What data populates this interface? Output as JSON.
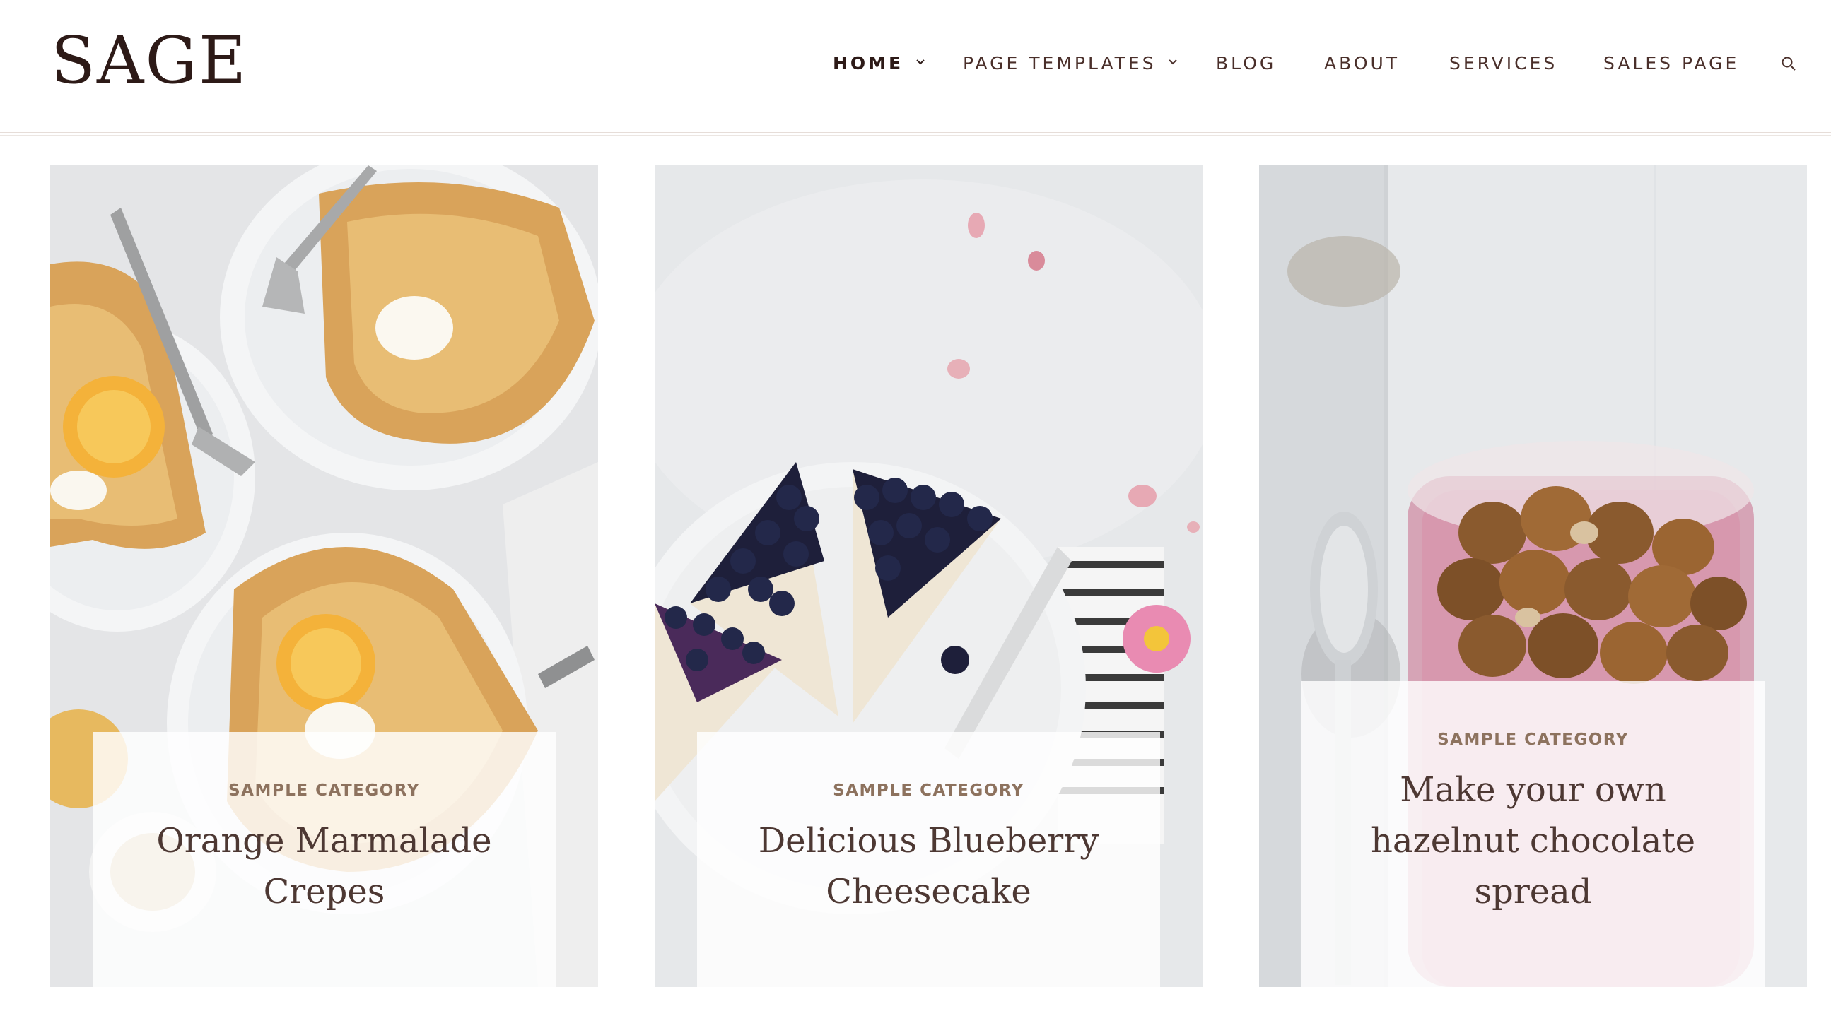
{
  "site": {
    "logo": "SAGE"
  },
  "nav": {
    "items": [
      {
        "label": "HOME",
        "has_dropdown": true,
        "active": true
      },
      {
        "label": "PAGE TEMPLATES",
        "has_dropdown": true,
        "active": false
      },
      {
        "label": "BLOG",
        "has_dropdown": false,
        "active": false
      },
      {
        "label": "ABOUT",
        "has_dropdown": false,
        "active": false
      },
      {
        "label": "SERVICES",
        "has_dropdown": false,
        "active": false
      },
      {
        "label": "SALES PAGE",
        "has_dropdown": false,
        "active": false
      }
    ],
    "search_icon": "search-icon"
  },
  "posts": [
    {
      "category": "SAMPLE CATEGORY",
      "title": "Orange Marmalade Crepes",
      "image": "crepes-photo"
    },
    {
      "category": "SAMPLE CATEGORY",
      "title": "Delicious Blueberry Cheesecake",
      "image": "blueberry-cheesecake-photo"
    },
    {
      "category": "SAMPLE CATEGORY",
      "title": "Make your own hazelnut chocolate spread",
      "image": "hazelnut-jar-photo"
    }
  ],
  "colors": {
    "logo": "#2d1a17",
    "nav_text": "#4a2f2a",
    "category": "#8d725e",
    "title": "#4d3833"
  }
}
